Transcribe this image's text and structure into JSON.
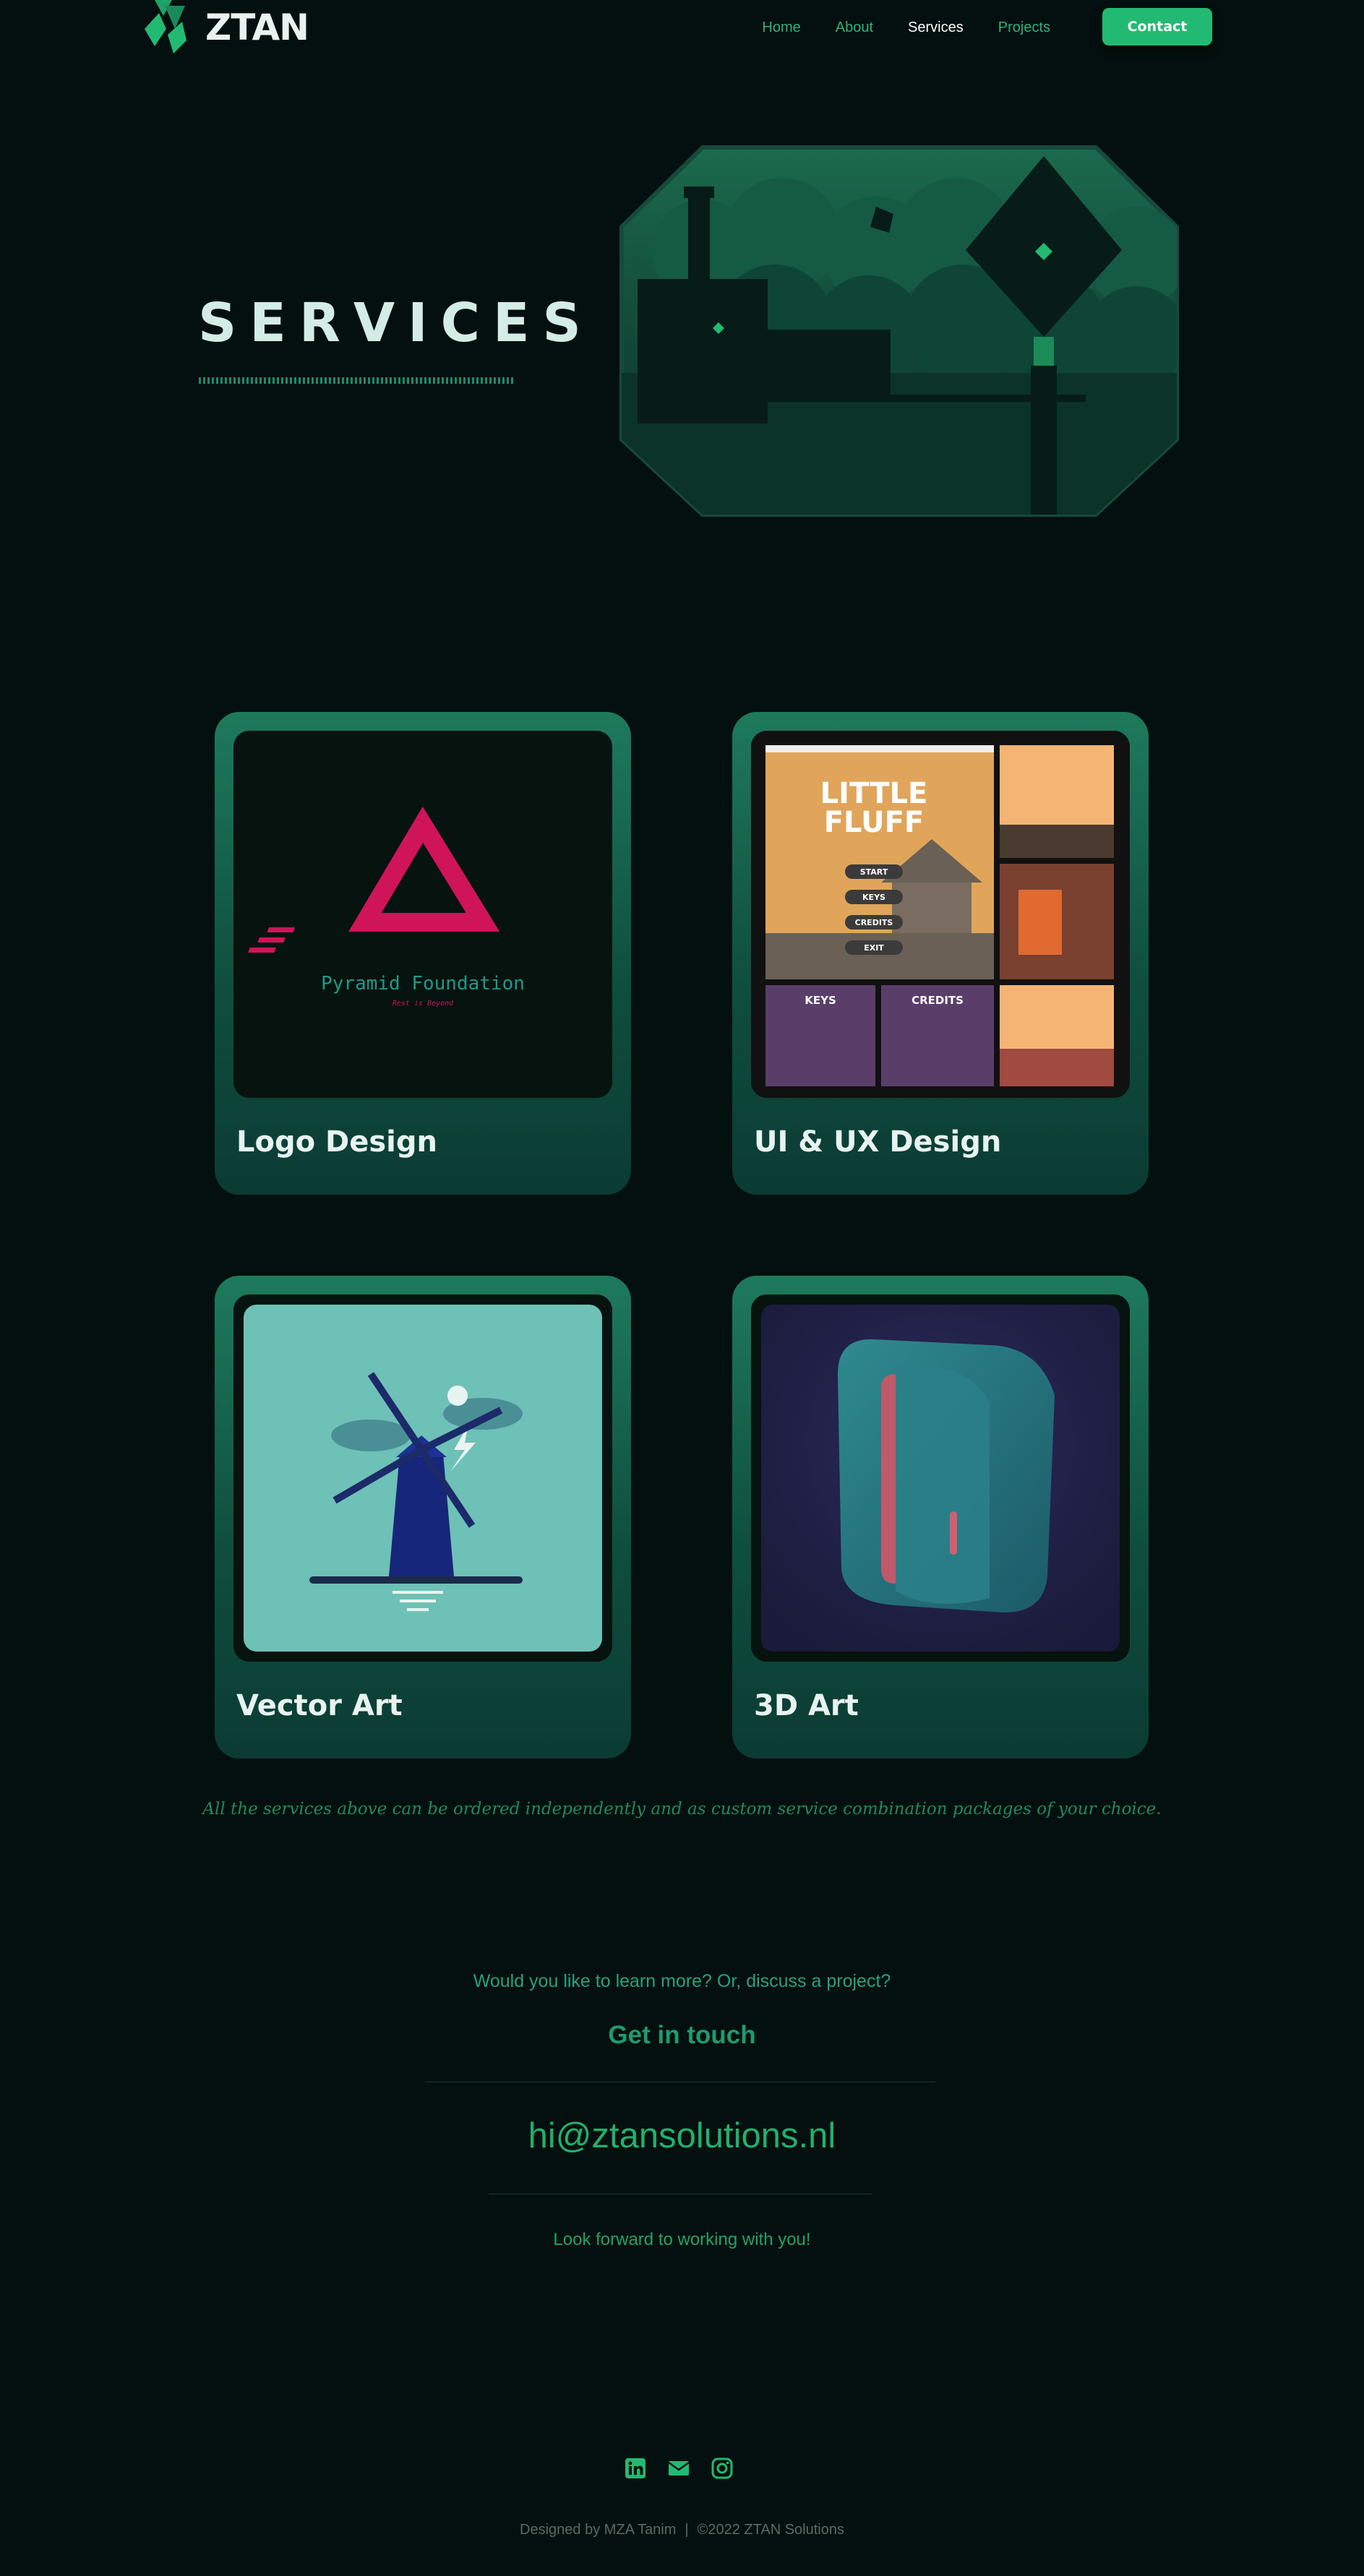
{
  "brand": {
    "name": "ZTAN"
  },
  "nav": {
    "links": [
      "Home",
      "About",
      "Services",
      "Projects"
    ],
    "active": "Services",
    "contact_label": "Contact"
  },
  "hero": {
    "title": "SERVICES"
  },
  "services": [
    {
      "label": "Logo Design",
      "image": "Pyramid Foundation logo",
      "logo_name": "Pyramid Foundation",
      "logo_tagline": "Rest is Beyond"
    },
    {
      "label": "UI & UX Design",
      "image": "Little Fluff game UI",
      "game_title_line1": "LITTLE",
      "game_title_line2": "FLUFF",
      "menu": [
        "START",
        "KEYS",
        "CREDITS",
        "EXIT"
      ],
      "keys_title": "KEYS",
      "credits_title": "CREDITS"
    },
    {
      "label": "Vector Art",
      "image": "windmill illustration"
    },
    {
      "label": "3D Art",
      "image": "3D fridge render"
    }
  ],
  "note": "All the services above can be ordered independently and as custom service combination packages of your choice.",
  "contact": {
    "question": "Would you like to learn more? Or, discuss a project?",
    "heading": "Get in touch",
    "email": "hi@ztansolutions.nl",
    "closing": "Look forward to working with you!"
  },
  "footer": {
    "designer": "Designed by MZA Tanim",
    "separator": "|",
    "copyright": "©2022 ZTAN Solutions",
    "social_icons": [
      "linkedin-icon",
      "envelope-icon",
      "instagram-icon"
    ]
  },
  "colors": {
    "background": "#04100f",
    "accent": "#22ba72",
    "card_top": "#1e7a5c",
    "card_bottom": "#0b3b33"
  }
}
